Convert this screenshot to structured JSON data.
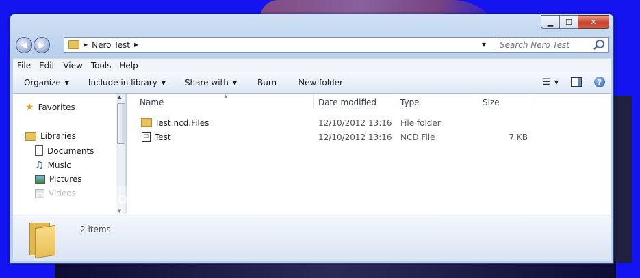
{
  "window": {
    "caption": {
      "minimize": "▁",
      "maximize": "☐",
      "close": "✕"
    }
  },
  "address": {
    "crumbs": [
      "Nero Test"
    ],
    "search_placeholder": "Search Nero Test"
  },
  "menu": [
    "File",
    "Edit",
    "View",
    "Tools",
    "Help"
  ],
  "toolbar": {
    "organize": "Organize",
    "include": "Include in library",
    "share": "Share with",
    "burn": "Burn",
    "new_folder": "New folder"
  },
  "nav": {
    "favorites": "Favorites",
    "libraries": "Libraries",
    "documents": "Documents",
    "music": "Music",
    "pictures": "Pictures",
    "videos": "Videos"
  },
  "columns": {
    "name": "Name",
    "date": "Date modified",
    "type": "Type",
    "size": "Size"
  },
  "files": [
    {
      "name": "Test.ncd.Files",
      "date": "12/10/2012 13:16",
      "type": "File folder",
      "size": "",
      "icon": "folder-icon"
    },
    {
      "name": "Test",
      "date": "12/10/2012 13:16",
      "type": "NCD File",
      "size": "7 KB",
      "icon": "ncd-file-icon"
    }
  ],
  "status": {
    "count": "2 items"
  },
  "overlay": {
    "watermark_text": "Protect more of your memories for less!"
  }
}
